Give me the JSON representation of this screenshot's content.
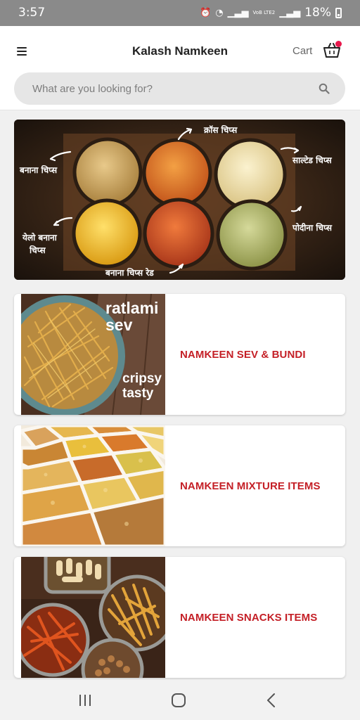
{
  "status_bar": {
    "time": "3:57",
    "battery": "18%",
    "network": "VoB LTE2"
  },
  "header": {
    "title": "Kalash Namkeen",
    "cart_label": "Cart"
  },
  "search": {
    "placeholder": "What are you looking for?"
  },
  "banner": {
    "labels": {
      "top_center": "क्रॉस चिप्स",
      "left_top": "बनाना चिप्स",
      "right_top": "साल्टेड चिप्स",
      "left_bottom_1": "येलो बनाना",
      "left_bottom_2": "चिप्स",
      "right_bottom": "पोदीना चिप्स",
      "bottom_center": "बनाना चिप्स रेड"
    }
  },
  "categories": [
    {
      "label": "NAMKEEN SEV & BUNDI",
      "image_text": [
        "ratlami",
        "sev",
        "cripsy",
        "tasty"
      ]
    },
    {
      "label": "NAMKEEN MIXTURE ITEMS"
    },
    {
      "label": "NAMKEEN SNACKS ITEMS"
    }
  ],
  "colors": {
    "accent": "#c41f26",
    "badge": "#e8184c",
    "status_bar": "#8a8a8a"
  }
}
